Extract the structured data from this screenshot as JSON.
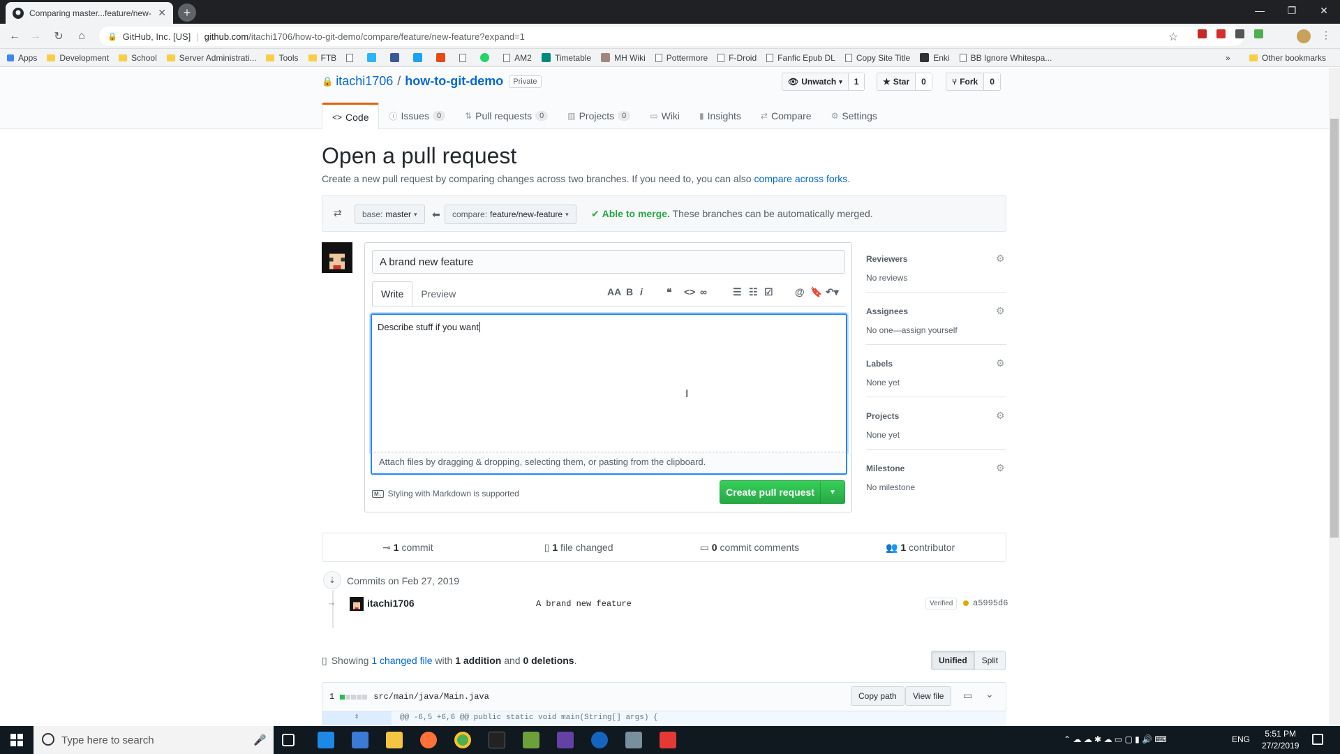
{
  "browser": {
    "tab_title": "Comparing master...feature/new-",
    "site_identity": "GitHub, Inc. [US]",
    "url_domain": "github.com",
    "url_path": "/itachi1706/how-to-git-demo/compare/feature/new-feature?expand=1",
    "bookmarks": [
      "Apps",
      "Development",
      "School",
      "Server Administrati...",
      "Tools",
      "FTB",
      "",
      "",
      "",
      "",
      "",
      "",
      "",
      "AM2",
      "Timetable",
      "MH Wiki",
      "Pottermore",
      "F-Droid",
      "Fanfic Epub DL",
      "Copy Site Title",
      "Enki",
      "BB Ignore Whitespa..."
    ],
    "bookmarks_more": "»",
    "other_bookmarks": "Other bookmarks"
  },
  "repo": {
    "owner": "itachi1706",
    "name": "how-to-git-demo",
    "visibility": "Private",
    "watch_label": "Unwatch",
    "watch_count": "1",
    "star_label": "Star",
    "star_count": "0",
    "fork_label": "Fork",
    "fork_count": "0",
    "tabs": [
      {
        "label": "Code",
        "count": ""
      },
      {
        "label": "Issues",
        "count": "0"
      },
      {
        "label": "Pull requests",
        "count": "0"
      },
      {
        "label": "Projects",
        "count": "0"
      },
      {
        "label": "Wiki",
        "count": ""
      },
      {
        "label": "Insights",
        "count": ""
      },
      {
        "label": "Compare",
        "count": ""
      },
      {
        "label": "Settings",
        "count": ""
      }
    ]
  },
  "compare": {
    "heading": "Open a pull request",
    "description": "Create a new pull request by comparing changes across two branches. If you need to, you can also ",
    "forks_link": "compare across forks",
    "period": ".",
    "base_label": "base:",
    "base_value": "master",
    "compare_label": "compare:",
    "compare_value": "feature/new-feature",
    "merge_status": "Able to merge.",
    "merge_detail": "These branches can be automatically merged."
  },
  "form": {
    "title_value": "A brand new feature",
    "tab_write": "Write",
    "tab_preview": "Preview",
    "body_value": "Describe stuff if you want",
    "attach_hint": "Attach files by dragging & dropping, selecting them, or pasting from the clipboard.",
    "markdown_note": "Styling with Markdown is supported",
    "submit_label": "Create pull request"
  },
  "sidebar": [
    {
      "heading": "Reviewers",
      "value": "No reviews"
    },
    {
      "heading": "Assignees",
      "value": "No one—assign yourself"
    },
    {
      "heading": "Labels",
      "value": "None yet"
    },
    {
      "heading": "Projects",
      "value": "None yet"
    },
    {
      "heading": "Milestone",
      "value": "No milestone"
    }
  ],
  "summary": {
    "commits_n": "1",
    "commits_l": "commit",
    "files_n": "1",
    "files_l": "file changed",
    "comments_n": "0",
    "comments_l": "commit comments",
    "contrib_n": "1",
    "contrib_l": "contributor"
  },
  "commits": {
    "date_heading": "Commits on Feb 27, 2019",
    "author": "itachi1706",
    "message": "A brand new feature",
    "verified": "Verified",
    "sha": "a5995d6"
  },
  "diff": {
    "showing": "Showing ",
    "changed_link": "1 changed file",
    "with": " with ",
    "additions": "1 addition",
    "and": " and ",
    "deletions": "0 deletions",
    "end": ".",
    "unified": "Unified",
    "split": "Split",
    "file_count": "1",
    "file_path": "src/main/java/Main.java",
    "copy_path": "Copy path",
    "view_file": "View file",
    "hunk": "@@ -6,5 +6,6 @@ public static void main(String[] args) {"
  },
  "taskbar": {
    "search_placeholder": "Type here to search",
    "lang": "ENG",
    "time": "5:51 PM",
    "date": "27/2/2019"
  },
  "colors": {
    "accent": "#0366d6",
    "merge": "#28a745",
    "primary_button": "#28a745",
    "tab_active": "#e36209"
  }
}
